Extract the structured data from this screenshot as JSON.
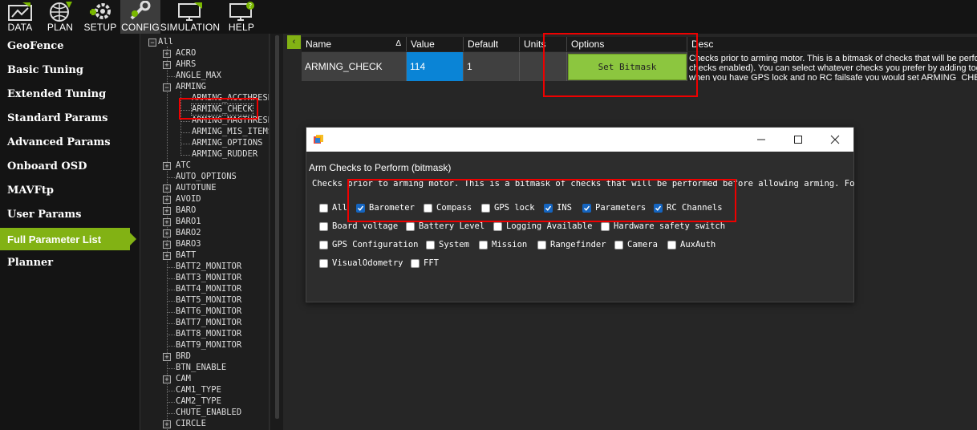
{
  "toolbar": {
    "items": [
      {
        "label": "DATA",
        "icon": "data-icon"
      },
      {
        "label": "PLAN",
        "icon": "plan-icon"
      },
      {
        "label": "SETUP",
        "icon": "setup-icon"
      },
      {
        "label": "CONFIG",
        "icon": "config-icon",
        "active": true
      },
      {
        "label": "SIMULATION",
        "icon": "simulation-icon"
      },
      {
        "label": "HELP",
        "icon": "help-icon"
      }
    ]
  },
  "leftnav": {
    "items": [
      "GeoFence",
      "Basic Tuning",
      "Extended Tuning",
      "Standard Params",
      "Advanced Params",
      "Onboard OSD",
      "MAVFtp",
      "User Params",
      "Full Parameter List",
      "Planner"
    ],
    "active": "Full Parameter List"
  },
  "tree": {
    "root": "All",
    "nodes": [
      "ACRO",
      "AHRS",
      "ANGLE_MAX",
      "ARMING",
      "ARMING_ACCTHRESH",
      "ARMING_CHECK",
      "ARMING_MAGTHRESH",
      "ARMING_MIS_ITEMS",
      "ARMING_OPTIONS",
      "ARMING_RUDDER",
      "ATC",
      "AUTO_OPTIONS",
      "AUTOTUNE",
      "AVOID",
      "BARO",
      "BARO1",
      "BARO2",
      "BARO3",
      "BATT",
      "BATT2_MONITOR",
      "BATT3_MONITOR",
      "BATT4_MONITOR",
      "BATT5_MONITOR",
      "BATT6_MONITOR",
      "BATT7_MONITOR",
      "BATT8_MONITOR",
      "BATT9_MONITOR",
      "BRD",
      "BTN_ENABLE",
      "CAM",
      "CAM1_TYPE",
      "CAM2_TYPE",
      "CHUTE_ENABLED",
      "CIRCLE"
    ],
    "selected": "ARMING_CHECK"
  },
  "grid": {
    "collapse_icon": "‹",
    "headers": {
      "name": "Name",
      "sort_glyph": "Δ",
      "value": "Value",
      "default": "Default",
      "units": "Units",
      "options": "Options",
      "desc": "Desc"
    },
    "row": {
      "name": "ARMING_CHECK",
      "value": "114",
      "default": "1",
      "units": "",
      "options_button": "Set Bitmask",
      "desc_lines": [
        "Checks prior to arming motor. This is a bitmask of checks that will be perform",
        "checks enabled). You can select whatever checks you prefer by adding tog",
        "when you have GPS lock and no RC failsafe you would set ARMING_CHECK"
      ]
    }
  },
  "dialog": {
    "heading": "Arm Checks to Perform (bitmask)",
    "description": "Checks prior to arming motor. This is a bitmask of checks that will be performed before allowing arming. For m",
    "checkboxes": [
      {
        "label": "All",
        "checked": false
      },
      {
        "label": "Barometer",
        "checked": true
      },
      {
        "label": "Compass",
        "checked": false
      },
      {
        "label": "GPS lock",
        "checked": false
      },
      {
        "label": "INS",
        "checked": true
      },
      {
        "label": "Parameters",
        "checked": true
      },
      {
        "label": "RC Channels",
        "checked": true
      },
      {
        "label": "Board voltage",
        "checked": false
      },
      {
        "label": "Battery Level",
        "checked": false
      },
      {
        "label": "Logging Available",
        "checked": false
      },
      {
        "label": "Hardware safety switch",
        "checked": false
      },
      {
        "label": "GPS Configuration",
        "checked": false
      },
      {
        "label": "System",
        "checked": false
      },
      {
        "label": "Mission",
        "checked": false
      },
      {
        "label": "Rangefinder",
        "checked": false
      },
      {
        "label": "Camera",
        "checked": false
      },
      {
        "label": "AuxAuth",
        "checked": false
      },
      {
        "label": "VisualOdometry",
        "checked": false
      },
      {
        "label": "FFT",
        "checked": false
      }
    ]
  },
  "colors": {
    "accent": "#82b214",
    "highlight_red": "#e00000",
    "value_blue": "#0a84d6",
    "check_blue": "#1565c0"
  }
}
